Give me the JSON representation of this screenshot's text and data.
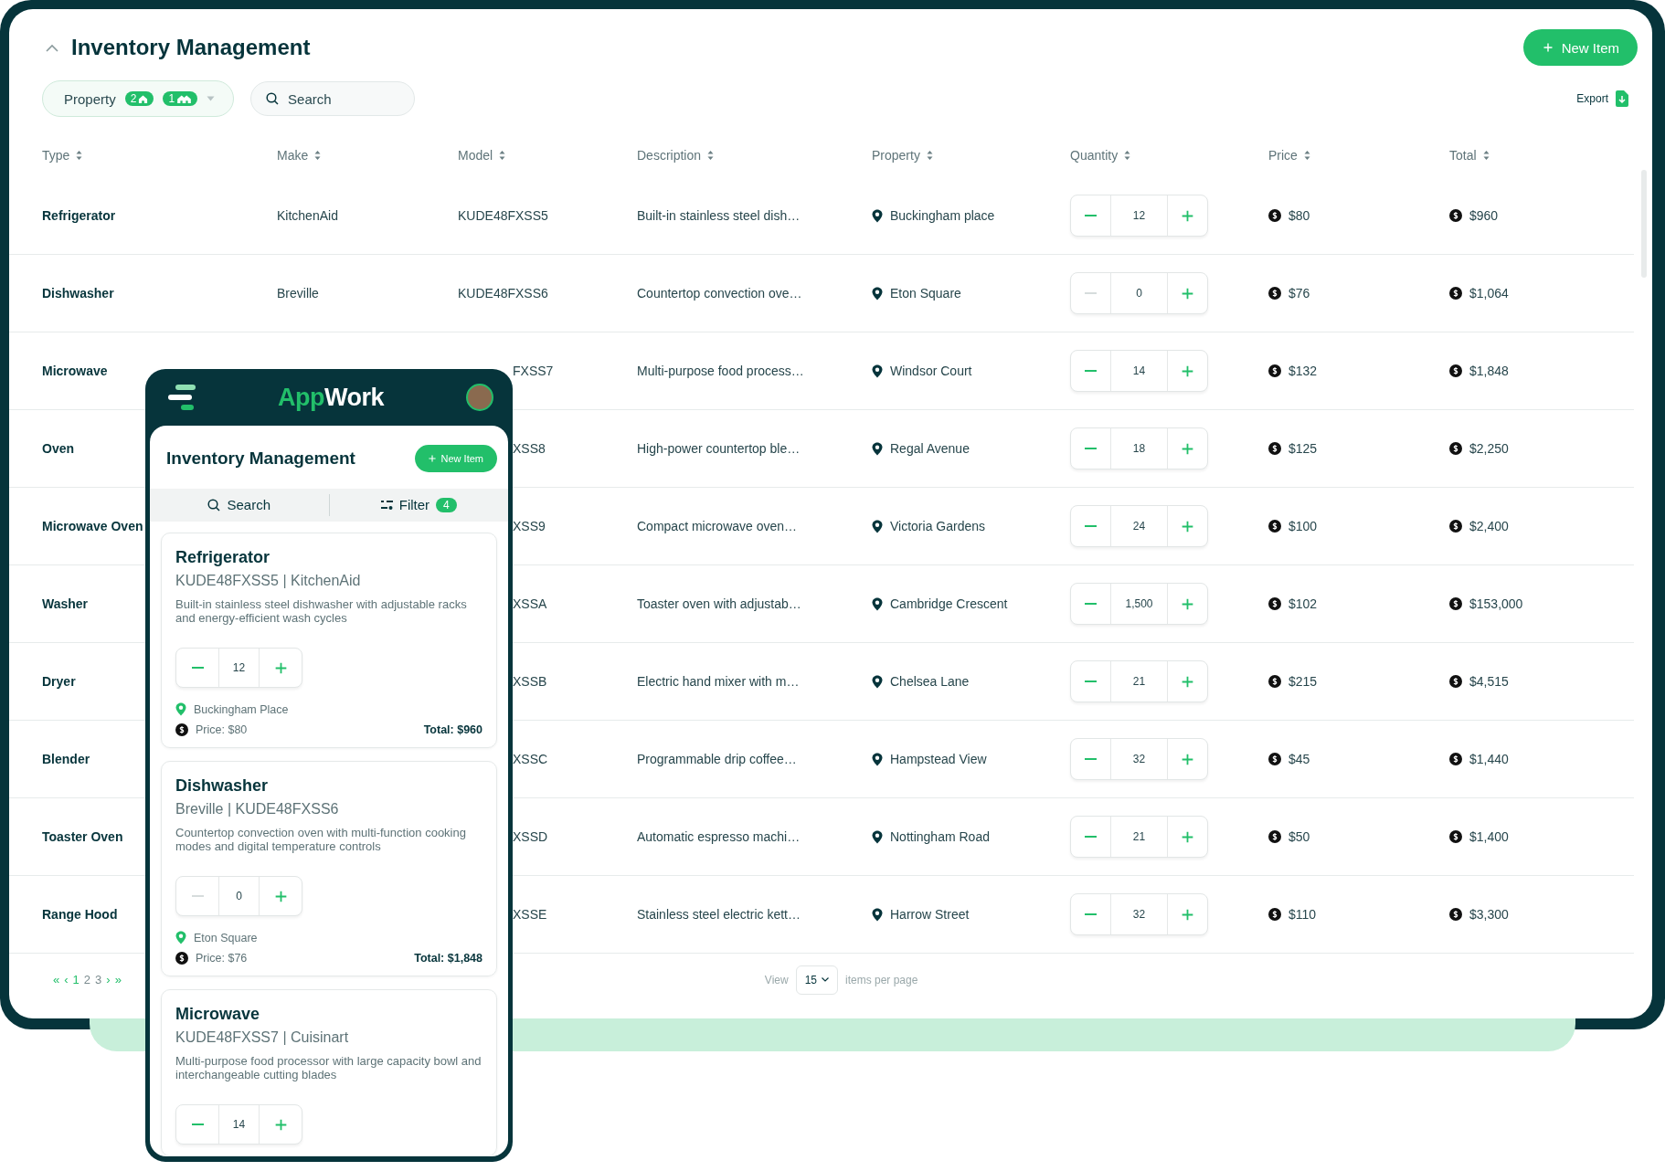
{
  "header": {
    "title": "Inventory Management",
    "new_item": "New Item"
  },
  "filters": {
    "property_label": "Property",
    "badges": [
      {
        "count": "2",
        "kind": "house"
      },
      {
        "count": "1",
        "kind": "houses"
      }
    ],
    "search_placeholder": "Search",
    "export": "Export"
  },
  "table": {
    "columns": [
      "Type",
      "Make",
      "Model",
      "Description",
      "Property",
      "Quantity",
      "Price",
      "Total"
    ],
    "rows": [
      {
        "type": "Refrigerator",
        "make": "KitchenAid",
        "model": "KUDE48FXSS5",
        "description": "Built-in stainless steel dish…",
        "property": "Buckingham place",
        "quantity": "12",
        "decrement_disabled": false,
        "price": "$80",
        "total": "$960"
      },
      {
        "type": "Dishwasher",
        "make": "Breville",
        "model": "KUDE48FXSS6",
        "description": "Countertop convection ove…",
        "property": "Eton Square",
        "quantity": "0",
        "decrement_disabled": true,
        "price": "$76",
        "total": "$1,064"
      },
      {
        "type": "Microwave",
        "model": "FXSS7",
        "description": "Multi-purpose food process…",
        "property": "Windsor Court",
        "quantity": "14",
        "decrement_disabled": false,
        "price": "$132",
        "total": "$1,848"
      },
      {
        "type": "Oven",
        "model": "XSS8",
        "description": "High-power countertop ble…",
        "property": "Regal Avenue",
        "quantity": "18",
        "decrement_disabled": false,
        "price": "$125",
        "total": "$2,250"
      },
      {
        "type": "Microwave Oven",
        "model": "XSS9",
        "description": "Compact microwave oven…",
        "property": "Victoria Gardens",
        "quantity": "24",
        "decrement_disabled": false,
        "price": "$100",
        "total": "$2,400"
      },
      {
        "type": "Washer",
        "model": "XSSA",
        "description": "Toaster oven with adjustab…",
        "property": "Cambridge Crescent",
        "quantity": "1,500",
        "decrement_disabled": false,
        "price": "$102",
        "total": "$153,000"
      },
      {
        "type": "Dryer",
        "model": "XSSB",
        "description": "Electric hand mixer with m…",
        "property": "Chelsea Lane",
        "quantity": "21",
        "decrement_disabled": false,
        "price": "$215",
        "total": "$4,515"
      },
      {
        "type": "Blender",
        "model": "XSSC",
        "description": "Programmable drip coffee…",
        "property": "Hampstead View",
        "quantity": "32",
        "decrement_disabled": false,
        "price": "$45",
        "total": "$1,440"
      },
      {
        "type": "Toaster Oven",
        "model": "XSSD",
        "description": "Automatic espresso machi…",
        "property": "Nottingham Road",
        "quantity": "21",
        "decrement_disabled": false,
        "price": "$50",
        "total": "$1,400"
      },
      {
        "type": "Range Hood",
        "model": "XSSE",
        "description": "Stainless steel electric kett…",
        "property": "Harrow Street",
        "quantity": "32",
        "decrement_disabled": false,
        "price": "$110",
        "total": "$3,300"
      }
    ]
  },
  "pagination": {
    "first": "«",
    "prev": "‹",
    "pages": [
      {
        "label": "1",
        "selected": true
      },
      {
        "label": "2",
        "selected": false
      },
      {
        "label": "3",
        "selected": false
      }
    ],
    "next": "›",
    "last": "»",
    "view_label": "View",
    "per_page": "15",
    "per_page_suffix": "items per page"
  },
  "mobile": {
    "brand": [
      {
        "text": "App",
        "accent": true
      },
      {
        "text": "Work",
        "accent": false
      }
    ],
    "title": "Inventory Management",
    "new_item": "New Item",
    "search": "Search",
    "filter": "Filter",
    "filter_count": "4",
    "cards": [
      {
        "title": "Refrigerator",
        "subtitle": "KUDE48FXSS5 | KitchenAid",
        "description": "Built-in stainless steel dishwasher with adjustable racks and energy-efficient wash cycles",
        "quantity": "12",
        "decrement_disabled": false,
        "property": "Buckingham Place",
        "price": "Price: $80",
        "total": "Total: $960"
      },
      {
        "title": "Dishwasher",
        "subtitle": "Breville | KUDE48FXSS6",
        "description": "Countertop convection oven with multi-function cooking modes and digital temperature controls",
        "quantity": "0",
        "decrement_disabled": true,
        "property": "Eton Square",
        "price": "Price: $76",
        "total": "Total: $1,848"
      },
      {
        "title": "Microwave",
        "subtitle": "KUDE48FXSS7 | Cuisinart",
        "description": "Multi-purpose food processor with large capacity bowl and interchangeable cutting blades",
        "quantity": "14",
        "decrement_disabled": false
      }
    ]
  }
}
